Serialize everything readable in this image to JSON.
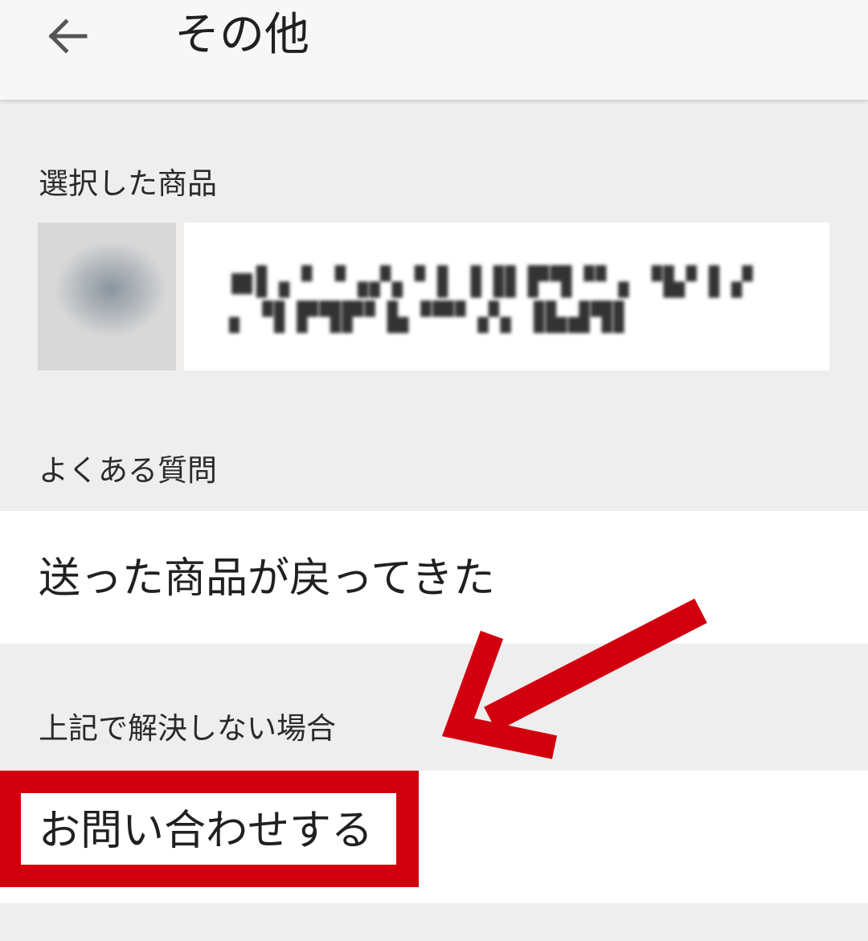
{
  "header": {
    "back_icon": "arrow-left-icon",
    "title": "その他"
  },
  "selected_product": {
    "section_label": "選択した商品",
    "name_line1": "■▌▖▘▝▗▞▖▘▌▐▐▌▛▜▝▘▖▝▙▘▌▞",
    "name_line2": "▖▝▌▛▜▛▘▙▝▀▘▞▖▐▙▟▜▌"
  },
  "faq": {
    "section_label": "よくある質問",
    "items": [
      {
        "label": "送った商品が戻ってきた"
      }
    ]
  },
  "support": {
    "section_label": "上記で解決しない場合",
    "contact_label": "お問い合わせする"
  },
  "annotation": {
    "highlight_color": "#d2000f"
  }
}
